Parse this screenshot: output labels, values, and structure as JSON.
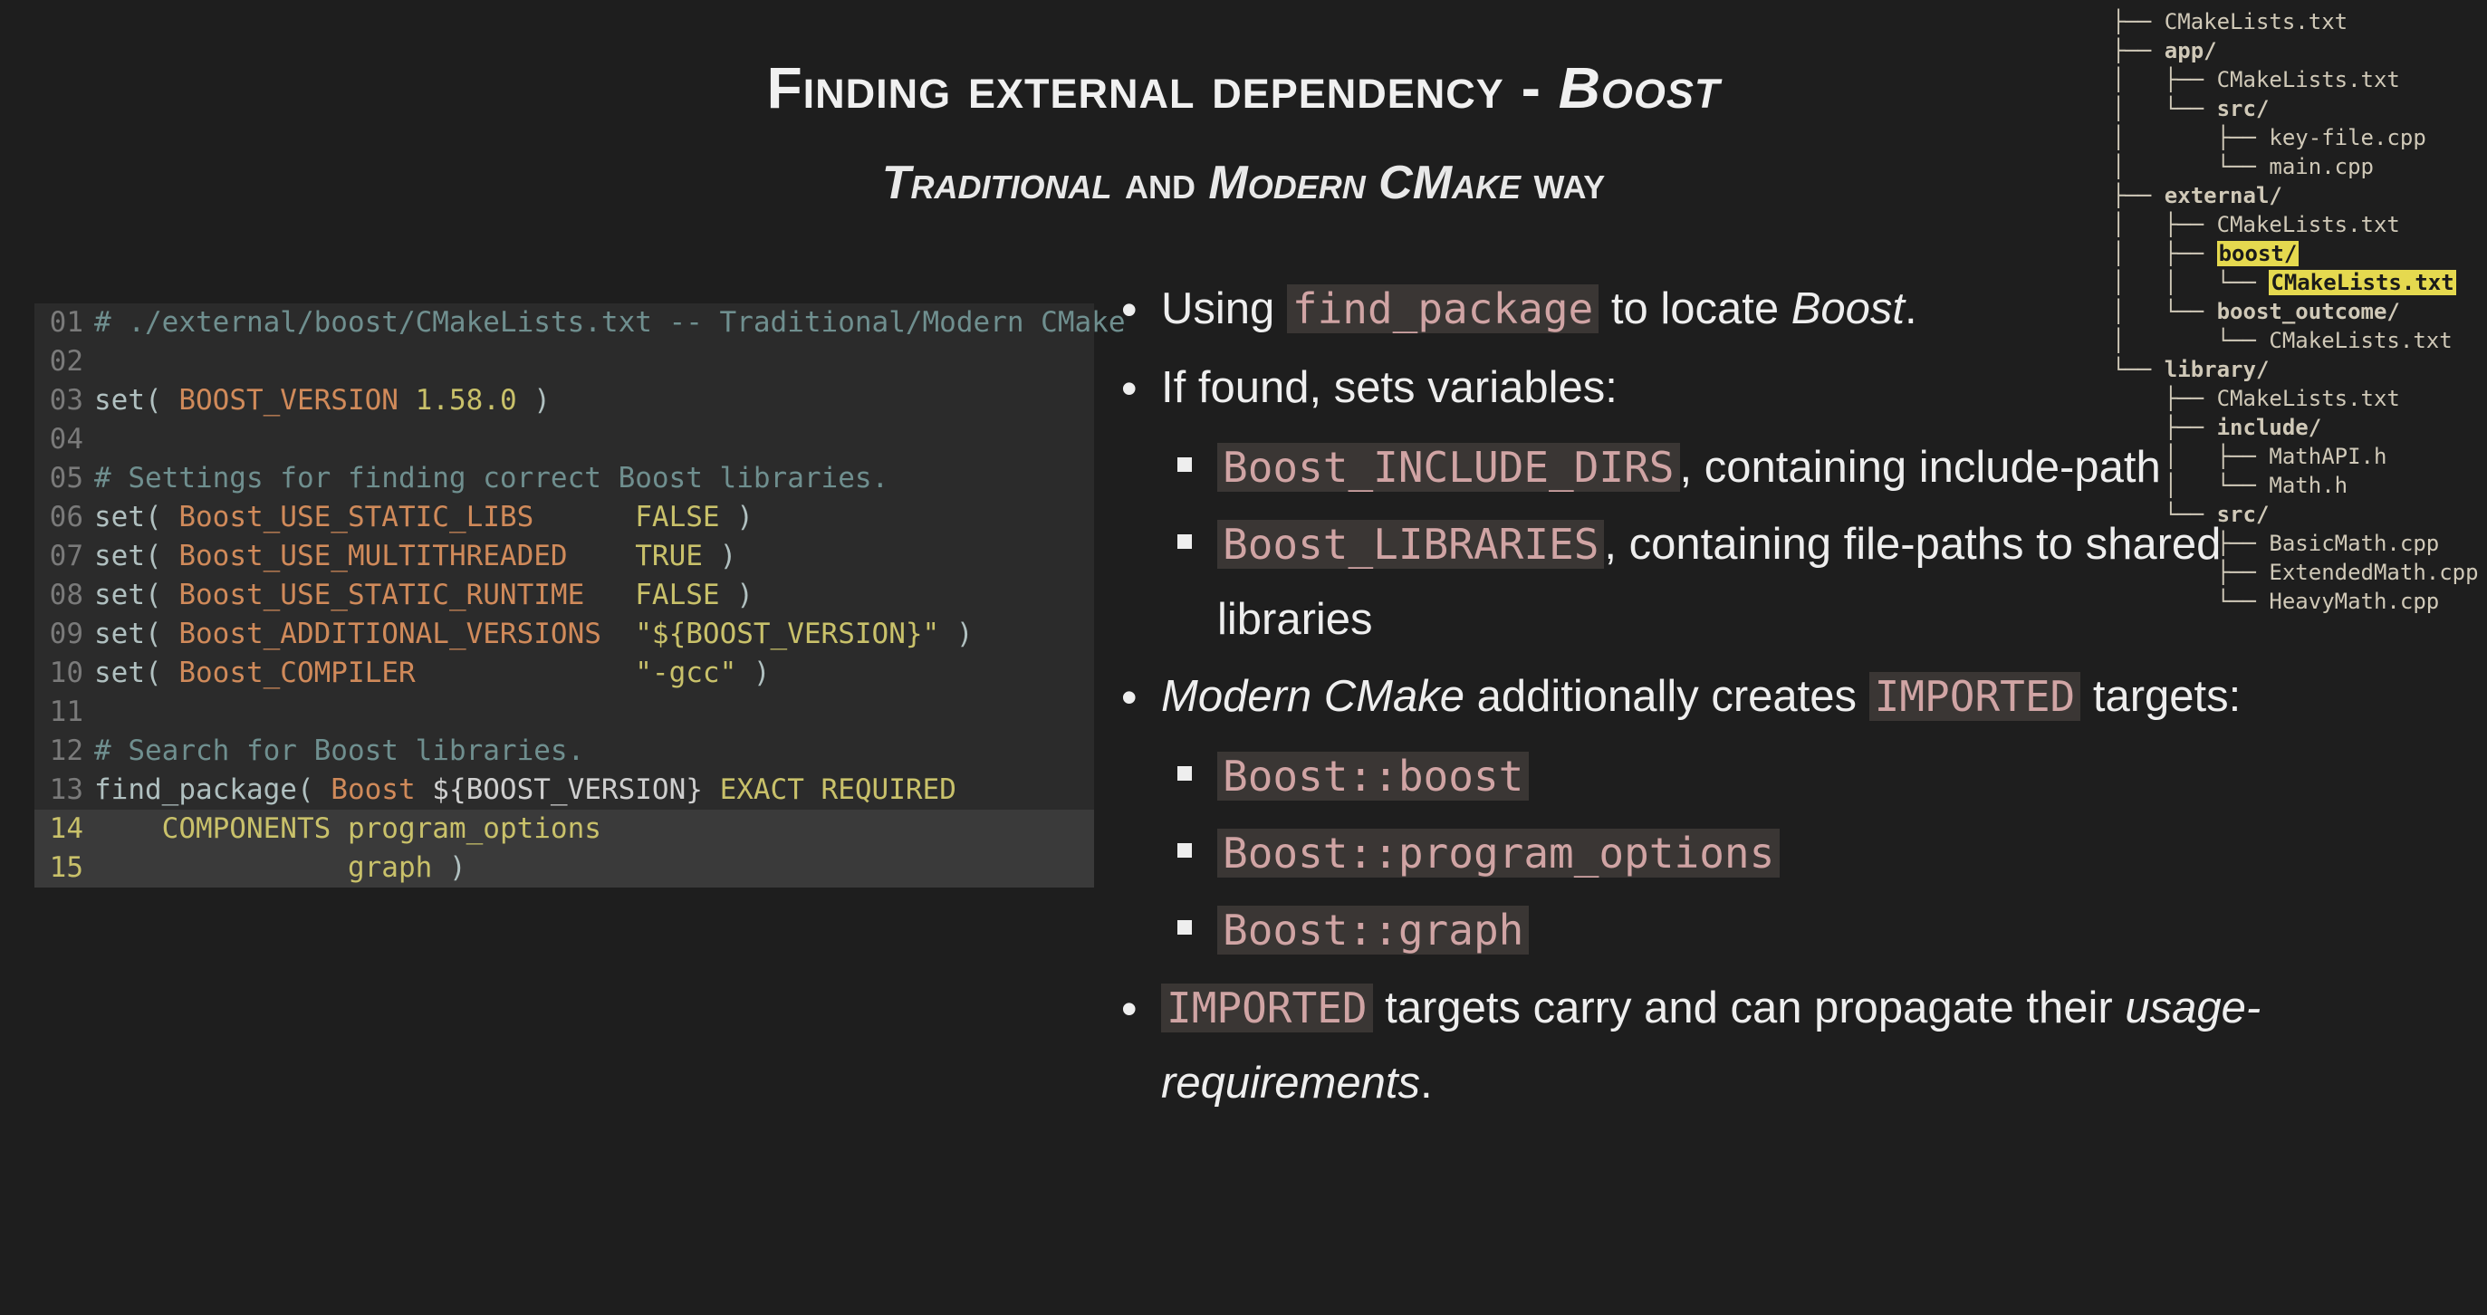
{
  "title": {
    "pre": "Finding external dependency - ",
    "boost": "Boost"
  },
  "subtitle": {
    "trad": "Traditional",
    "and": " and ",
    "modern": "Modern CMake",
    "way": " way"
  },
  "code": {
    "lines": [
      {
        "n": "01",
        "seg": [
          {
            "c": "tok-comment",
            "t": "# ./external/boost/CMakeLists.txt -- Traditional/Modern CMake"
          }
        ]
      },
      {
        "n": "02",
        "seg": []
      },
      {
        "n": "03",
        "seg": [
          {
            "c": "tok-key",
            "t": "set( "
          },
          {
            "c": "tok-var",
            "t": "BOOST_VERSION "
          },
          {
            "c": "tok-lit",
            "t": "1.58.0"
          },
          {
            "c": "tok-key",
            "t": " )"
          }
        ]
      },
      {
        "n": "04",
        "seg": []
      },
      {
        "n": "05",
        "seg": [
          {
            "c": "tok-comment",
            "t": "# Settings for finding correct Boost libraries."
          }
        ]
      },
      {
        "n": "06",
        "seg": [
          {
            "c": "tok-key",
            "t": "set( "
          },
          {
            "c": "tok-var",
            "t": "Boost_USE_STATIC_LIBS"
          },
          {
            "c": "tok-plain",
            "t": "      "
          },
          {
            "c": "tok-lit",
            "t": "FALSE"
          },
          {
            "c": "tok-key",
            "t": " )"
          }
        ]
      },
      {
        "n": "07",
        "seg": [
          {
            "c": "tok-key",
            "t": "set( "
          },
          {
            "c": "tok-var",
            "t": "Boost_USE_MULTITHREADED"
          },
          {
            "c": "tok-plain",
            "t": "    "
          },
          {
            "c": "tok-lit",
            "t": "TRUE"
          },
          {
            "c": "tok-key",
            "t": " )"
          }
        ]
      },
      {
        "n": "08",
        "seg": [
          {
            "c": "tok-key",
            "t": "set( "
          },
          {
            "c": "tok-var",
            "t": "Boost_USE_STATIC_RUNTIME"
          },
          {
            "c": "tok-plain",
            "t": "   "
          },
          {
            "c": "tok-lit",
            "t": "FALSE"
          },
          {
            "c": "tok-key",
            "t": " )"
          }
        ]
      },
      {
        "n": "09",
        "seg": [
          {
            "c": "tok-key",
            "t": "set( "
          },
          {
            "c": "tok-var",
            "t": "Boost_ADDITIONAL_VERSIONS"
          },
          {
            "c": "tok-plain",
            "t": "  "
          },
          {
            "c": "tok-str",
            "t": "\"${BOOST_VERSION}\""
          },
          {
            "c": "tok-key",
            "t": " )"
          }
        ]
      },
      {
        "n": "10",
        "seg": [
          {
            "c": "tok-key",
            "t": "set( "
          },
          {
            "c": "tok-var",
            "t": "Boost_COMPILER"
          },
          {
            "c": "tok-plain",
            "t": "             "
          },
          {
            "c": "tok-str",
            "t": "\"-gcc\""
          },
          {
            "c": "tok-key",
            "t": " )"
          }
        ]
      },
      {
        "n": "11",
        "seg": []
      },
      {
        "n": "12",
        "seg": [
          {
            "c": "tok-comment",
            "t": "# Search for Boost libraries."
          }
        ]
      },
      {
        "n": "13",
        "seg": [
          {
            "c": "tok-key",
            "t": "find_package( "
          },
          {
            "c": "tok-var",
            "t": "Boost "
          },
          {
            "c": "tok-plain",
            "t": "${BOOST_VERSION} "
          },
          {
            "c": "tok-lit",
            "t": "EXACT REQUIRED"
          }
        ]
      },
      {
        "n": "14",
        "hl": true,
        "seg": [
          {
            "c": "tok-plain",
            "t": "    "
          },
          {
            "c": "tok-lit",
            "t": "COMPONENTS "
          },
          {
            "c": "tok-str",
            "t": "program_options"
          }
        ]
      },
      {
        "n": "15",
        "hl": true,
        "seg": [
          {
            "c": "tok-plain",
            "t": "               "
          },
          {
            "c": "tok-str",
            "t": "graph"
          },
          {
            "c": "tok-key",
            "t": " )"
          }
        ]
      }
    ]
  },
  "bullets": {
    "b1_pre": "Using ",
    "b1_code": "find_package",
    "b1_post": " to locate ",
    "b1_boost": "Boost",
    "b1_end": ".",
    "b2": "If found, sets variables:",
    "b2a_code": "Boost_INCLUDE_DIRS",
    "b2a_post": ", containing include-path",
    "b2b_code": "Boost_LIBRARIES",
    "b2b_post": ", containing file-paths to shared libraries",
    "b3_pre_it": "Modern CMake",
    "b3_mid": " additionally creates ",
    "b3_code": "IMPORTED",
    "b3_post": " targets:",
    "b3a": "Boost::boost",
    "b3b": "Boost::program_options",
    "b3c": "Boost::graph",
    "b4_code": "IMPORTED",
    "b4_mid": " targets carry and can propagate their ",
    "b4_it": "usage-requirements",
    "b4_end": "."
  },
  "tree": {
    "rows": [
      {
        "t": "├── CMakeLists.txt"
      },
      {
        "t": "├── ",
        "suffix": "app/",
        "bold": true
      },
      {
        "t": "│   ├── CMakeLists.txt"
      },
      {
        "t": "│   └── ",
        "suffix": "src/",
        "bold": true
      },
      {
        "t": "│       ├── key-file.cpp"
      },
      {
        "t": "│       └── main.cpp"
      },
      {
        "t": "├── ",
        "suffix": "external/",
        "bold": true
      },
      {
        "t": "│   ├── CMakeLists.txt"
      },
      {
        "t": "│   ├── ",
        "suffix": "boost/",
        "bold": true,
        "hlSuffix": true
      },
      {
        "t": "│   │   └── ",
        "suffix": "CMakeLists.txt",
        "hlSuffix": true,
        "bold": true
      },
      {
        "t": "│   └── ",
        "suffix": "boost_outcome/",
        "bold": true
      },
      {
        "t": "│       └── CMakeLists.txt"
      },
      {
        "t": "└── ",
        "suffix": "library/",
        "bold": true
      },
      {
        "t": "    ├── CMakeLists.txt"
      },
      {
        "t": "    ├── ",
        "suffix": "include/",
        "bold": true
      },
      {
        "t": "    │   ├── MathAPI.h"
      },
      {
        "t": "    │   └── Math.h"
      },
      {
        "t": "    └── ",
        "suffix": "src/",
        "bold": true
      },
      {
        "t": "        ├── BasicMath.cpp"
      },
      {
        "t": "        ├── ExtendedMath.cpp"
      },
      {
        "t": "        └── HeavyMath.cpp"
      }
    ]
  }
}
